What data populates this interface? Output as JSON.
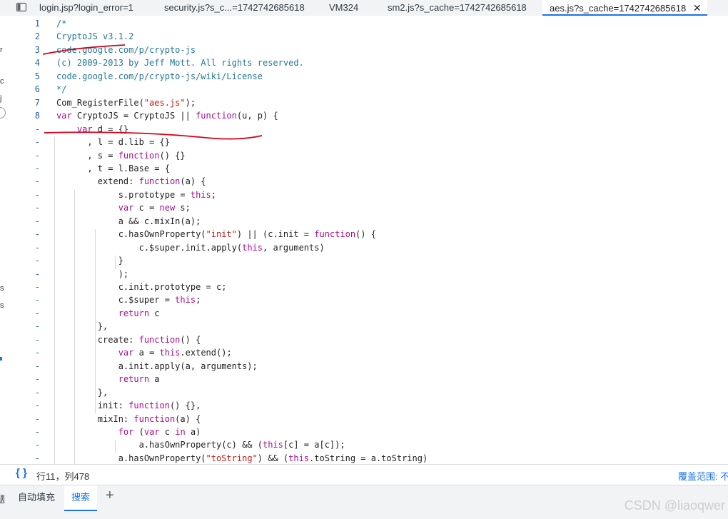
{
  "tabs": [
    {
      "label": "login.jsp?login_error=1"
    },
    {
      "label": "security.js?s_c...=1742742685618"
    },
    {
      "label": "VM324"
    },
    {
      "label": "sm2.js?s_cache=1742742685618"
    },
    {
      "label": "aes.js?s_cache=1742742685618"
    }
  ],
  "left_strip_chars": [
    "r",
    "c",
    "j",
    "s",
    "s"
  ],
  "code_lines": [
    {
      "num": "1",
      "tokens": [
        {
          "t": "/*",
          "c": "t-com"
        }
      ]
    },
    {
      "num": "2",
      "tokens": [
        {
          "t": "CryptoJS v3.1.2",
          "c": "t-com"
        }
      ]
    },
    {
      "num": "3",
      "tokens": [
        {
          "t": "code.google.com/p/crypto-js",
          "c": "t-com"
        }
      ]
    },
    {
      "num": "4",
      "tokens": [
        {
          "t": "(c) 2009-2013 by Jeff Mott. All rights reserved.",
          "c": "t-com"
        }
      ]
    },
    {
      "num": "5",
      "tokens": [
        {
          "t": "code.google.com/p/crypto-js/wiki/License",
          "c": "t-com"
        }
      ]
    },
    {
      "num": "6",
      "tokens": [
        {
          "t": "*/",
          "c": "t-com"
        }
      ]
    },
    {
      "num": "7",
      "tokens": [
        {
          "t": "Com_RegisterFile(",
          "c": "t-id"
        },
        {
          "t": "\"aes.js\"",
          "c": "t-str"
        },
        {
          "t": ");",
          "c": "t-id"
        }
      ]
    },
    {
      "num": "8",
      "tokens": [
        {
          "t": "var",
          "c": "t-kw"
        },
        {
          "t": " CryptoJS = CryptoJS || ",
          "c": "t-id"
        },
        {
          "t": "function",
          "c": "t-kw"
        },
        {
          "t": "(u, p) {",
          "c": "t-id"
        }
      ]
    },
    {
      "num": "-",
      "tokens": [
        {
          "t": "    var",
          "c": "t-kw"
        },
        {
          "t": " d = {}",
          "c": "t-id"
        }
      ]
    },
    {
      "num": "-",
      "tokens": [
        {
          "t": "      , l = d.lib = {}",
          "c": "t-id"
        }
      ]
    },
    {
      "num": "-",
      "tokens": [
        {
          "t": "      , s = ",
          "c": "t-id"
        },
        {
          "t": "function",
          "c": "t-kw"
        },
        {
          "t": "() {}",
          "c": "t-id"
        }
      ]
    },
    {
      "num": "-",
      "tokens": [
        {
          "t": "      , t = l.Base = {",
          "c": "t-id"
        }
      ]
    },
    {
      "num": "-",
      "tokens": [
        {
          "t": "        extend: ",
          "c": "t-id"
        },
        {
          "t": "function",
          "c": "t-kw"
        },
        {
          "t": "(a) {",
          "c": "t-id"
        }
      ]
    },
    {
      "num": "-",
      "tokens": [
        {
          "t": "            s.prototype = ",
          "c": "t-id"
        },
        {
          "t": "this",
          "c": "t-kw"
        },
        {
          "t": ";",
          "c": "t-id"
        }
      ]
    },
    {
      "num": "-",
      "tokens": [
        {
          "t": "            ",
          "c": "t-id"
        },
        {
          "t": "var",
          "c": "t-kw"
        },
        {
          "t": " c = ",
          "c": "t-id"
        },
        {
          "t": "new",
          "c": "t-kw"
        },
        {
          "t": " s;",
          "c": "t-id"
        }
      ]
    },
    {
      "num": "-",
      "tokens": [
        {
          "t": "            a && c.mixIn(a);",
          "c": "t-id"
        }
      ]
    },
    {
      "num": "-",
      "tokens": [
        {
          "t": "            c.hasOwnProperty(",
          "c": "t-id"
        },
        {
          "t": "\"init\"",
          "c": "t-str"
        },
        {
          "t": ") || (c.init = ",
          "c": "t-id"
        },
        {
          "t": "function",
          "c": "t-kw"
        },
        {
          "t": "() {",
          "c": "t-id"
        }
      ]
    },
    {
      "num": "-",
      "tokens": [
        {
          "t": "                c.$super.init.apply(",
          "c": "t-id"
        },
        {
          "t": "this",
          "c": "t-kw"
        },
        {
          "t": ", arguments)",
          "c": "t-id"
        }
      ]
    },
    {
      "num": "-",
      "tokens": [
        {
          "t": "            }",
          "c": "t-id"
        }
      ]
    },
    {
      "num": "-",
      "tokens": [
        {
          "t": "            );",
          "c": "t-id"
        }
      ]
    },
    {
      "num": "-",
      "tokens": [
        {
          "t": "            c.init.prototype = c;",
          "c": "t-id"
        }
      ]
    },
    {
      "num": "-",
      "tokens": [
        {
          "t": "            c.$super = ",
          "c": "t-id"
        },
        {
          "t": "this",
          "c": "t-kw"
        },
        {
          "t": ";",
          "c": "t-id"
        }
      ]
    },
    {
      "num": "-",
      "tokens": [
        {
          "t": "            ",
          "c": "t-id"
        },
        {
          "t": "return",
          "c": "t-kw"
        },
        {
          "t": " c",
          "c": "t-id"
        }
      ]
    },
    {
      "num": "-",
      "tokens": [
        {
          "t": "        },",
          "c": "t-id"
        }
      ]
    },
    {
      "num": "-",
      "tokens": [
        {
          "t": "        create: ",
          "c": "t-id"
        },
        {
          "t": "function",
          "c": "t-kw"
        },
        {
          "t": "() {",
          "c": "t-id"
        }
      ]
    },
    {
      "num": "-",
      "tokens": [
        {
          "t": "            ",
          "c": "t-id"
        },
        {
          "t": "var",
          "c": "t-kw"
        },
        {
          "t": " a = ",
          "c": "t-id"
        },
        {
          "t": "this",
          "c": "t-kw"
        },
        {
          "t": ".extend();",
          "c": "t-id"
        }
      ]
    },
    {
      "num": "-",
      "tokens": [
        {
          "t": "            a.init.apply(a, arguments);",
          "c": "t-id"
        }
      ]
    },
    {
      "num": "-",
      "tokens": [
        {
          "t": "            ",
          "c": "t-id"
        },
        {
          "t": "return",
          "c": "t-kw"
        },
        {
          "t": " a",
          "c": "t-id"
        }
      ]
    },
    {
      "num": "-",
      "tokens": [
        {
          "t": "        },",
          "c": "t-id"
        }
      ]
    },
    {
      "num": "-",
      "tokens": [
        {
          "t": "        init: ",
          "c": "t-id"
        },
        {
          "t": "function",
          "c": "t-kw"
        },
        {
          "t": "() {},",
          "c": "t-id"
        }
      ]
    },
    {
      "num": "-",
      "tokens": [
        {
          "t": "        mixIn: ",
          "c": "t-id"
        },
        {
          "t": "function",
          "c": "t-kw"
        },
        {
          "t": "(a) {",
          "c": "t-id"
        }
      ]
    },
    {
      "num": "-",
      "tokens": [
        {
          "t": "            ",
          "c": "t-id"
        },
        {
          "t": "for",
          "c": "t-kw"
        },
        {
          "t": " (",
          "c": "t-id"
        },
        {
          "t": "var",
          "c": "t-kw"
        },
        {
          "t": " c ",
          "c": "t-id"
        },
        {
          "t": "in",
          "c": "t-kw"
        },
        {
          "t": " a)",
          "c": "t-id"
        }
      ]
    },
    {
      "num": "-",
      "tokens": [
        {
          "t": "                a.hasOwnProperty(c) && (",
          "c": "t-id"
        },
        {
          "t": "this",
          "c": "t-kw"
        },
        {
          "t": "[c] = a[c]);",
          "c": "t-id"
        }
      ]
    },
    {
      "num": "-",
      "tokens": [
        {
          "t": "            a.hasOwnProperty(",
          "c": "t-id"
        },
        {
          "t": "\"toString\"",
          "c": "t-str"
        },
        {
          "t": ") && (",
          "c": "t-id"
        },
        {
          "t": "this",
          "c": "t-kw"
        },
        {
          "t": ".toString = a.toString)",
          "c": "t-id"
        }
      ]
    }
  ],
  "status": {
    "braces_icon": "{ }",
    "position": "行11，列478",
    "coverage": "覆盖范围: 不"
  },
  "drawer": {
    "tabs": [
      "自动填充",
      "搜索"
    ],
    "add_icon": "plus-icon",
    "left_fragment": "题"
  },
  "watermark": "CSDN @liaoqwer",
  "annotation_color": "#d9001b"
}
